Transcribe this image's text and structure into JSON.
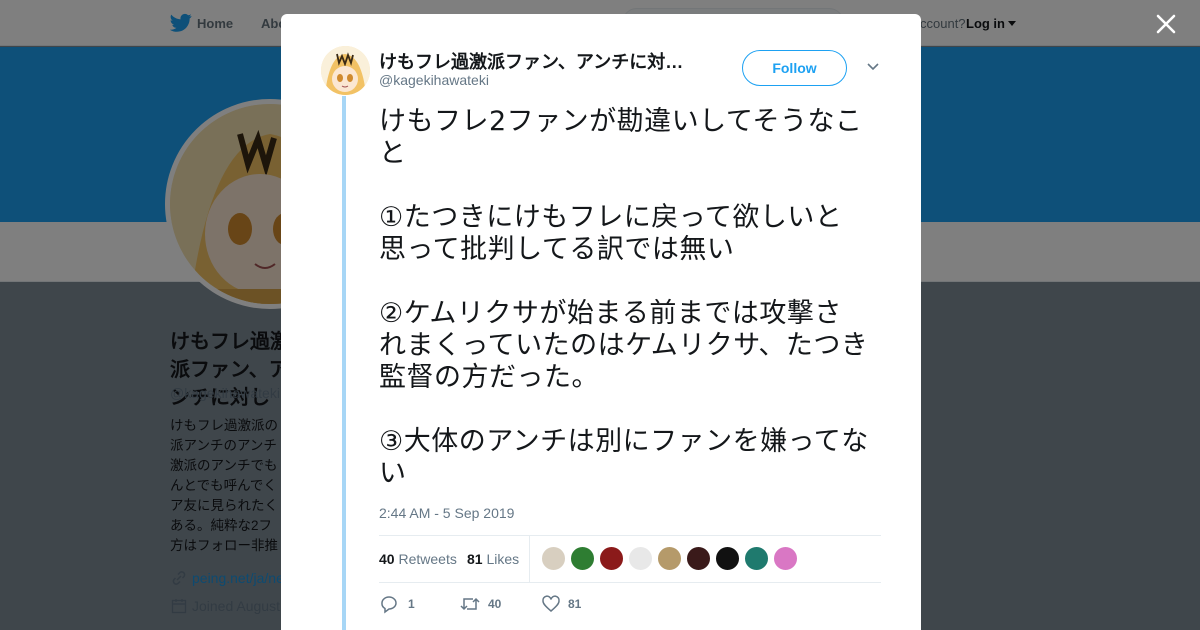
{
  "nav": {
    "home_label": "Home",
    "about_label": "Abo",
    "account_prompt": "ccount?",
    "login_label": "Log in"
  },
  "profile": {
    "name": "けもフレ過激派ファン、アンチに対し",
    "handle": "@kagekihawateki",
    "bio": "けもフレ過激派の派アンチのアンチ激派のアンチでもんとでも呼んでくア友に見られたくある。純粋な2フ方はフォロー非推",
    "link": "peing.net/ja/ne",
    "joined": "Joined August"
  },
  "tweet": {
    "author_name": "けもフレ過激派ファン、アンチに対…",
    "author_handle": "@kagekihawateki",
    "follow_label": "Follow",
    "text": "けもフレ2ファンが勘違いしてそうなこと\n\n①たつきにけもフレに戻って欲しいと思って批判してる訳では無い\n\n②ケムリクサが始まる前までは攻撃されまくっていたのはケムリクサ、たつき監督の方だった。\n\n③大体のアンチは別にファンを嫌ってない",
    "timestamp": "2:44 AM - 5 Sep 2019",
    "retweets_count": "40",
    "retweets_label": "Retweets",
    "likes_count": "81",
    "likes_label": "Likes",
    "reply_count": "1",
    "retweet_action_count": "40",
    "like_action_count": "81"
  },
  "likers": [
    {
      "name": "liker-avatar-1",
      "color": "#d8cfc0"
    },
    {
      "name": "liker-avatar-2",
      "color": "#2e7d32"
    },
    {
      "name": "liker-avatar-3",
      "color": "#8b1a1a"
    },
    {
      "name": "liker-avatar-4",
      "color": "#e8e8e8"
    },
    {
      "name": "liker-avatar-5",
      "color": "#b59a6a"
    },
    {
      "name": "liker-avatar-6",
      "color": "#3a1a1a"
    },
    {
      "name": "liker-avatar-7",
      "color": "#111111"
    },
    {
      "name": "liker-avatar-8",
      "color": "#1f7a6e"
    },
    {
      "name": "liker-avatar-9",
      "color": "#d977c4"
    }
  ],
  "colors": {
    "accent": "#1da1f2",
    "thread_line": "#a7d6f6",
    "text_primary": "#14171a",
    "text_secondary": "#657786"
  }
}
